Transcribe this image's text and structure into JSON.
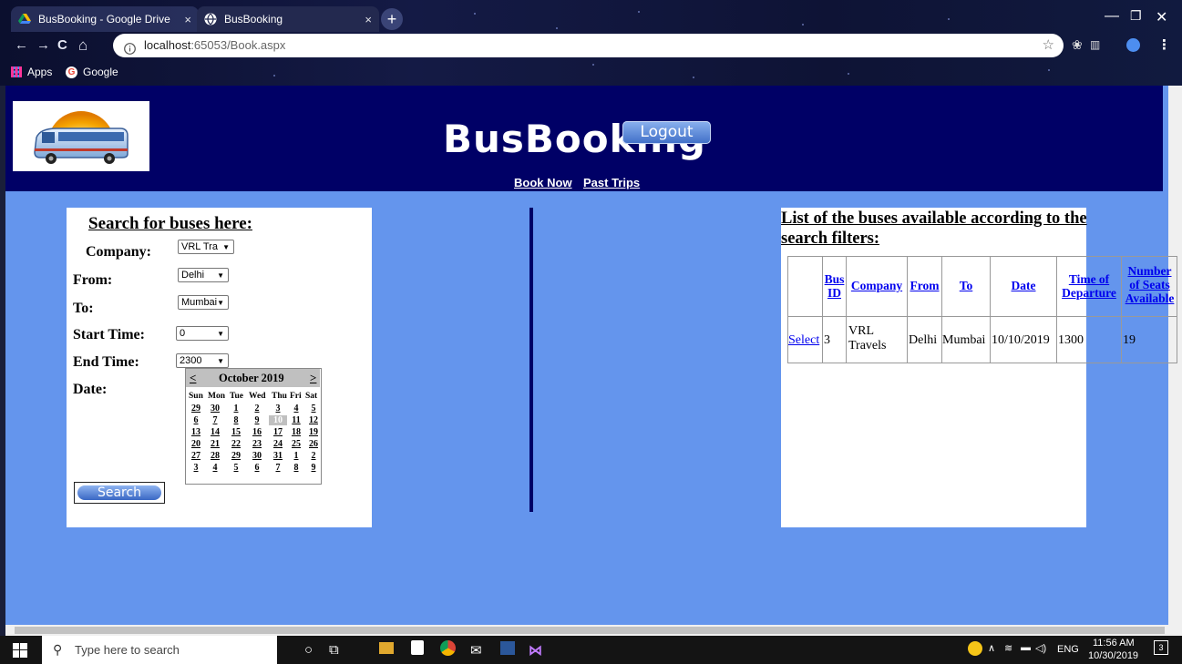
{
  "browser": {
    "tabs": [
      {
        "title": "BusBooking - Google Drive",
        "close": "×"
      },
      {
        "title": "BusBooking",
        "close": "×"
      }
    ],
    "new_tab": "+",
    "window_controls": {
      "minimize": "—",
      "maximize": "❐",
      "close": "✕"
    },
    "nav": {
      "back": "←",
      "forward": "→",
      "reload": "C",
      "home": "⌂"
    },
    "url_host": "localhost",
    "url_path": ":65053/Book.aspx",
    "bookmarks": [
      {
        "label": "Apps"
      },
      {
        "label": "Google"
      }
    ]
  },
  "site": {
    "title": "BusBooking",
    "logout_label": "Logout",
    "menu": [
      "Book Now",
      "Past Trips"
    ]
  },
  "search": {
    "heading": "Search for buses here:",
    "fields": {
      "company": {
        "label": "Company:",
        "value": "VRL Tra"
      },
      "from": {
        "label": "From:",
        "value": "Delhi"
      },
      "to": {
        "label": "To:",
        "value": "Mumbai"
      },
      "start_time": {
        "label": "Start Time:",
        "value": "0"
      },
      "end_time": {
        "label": "End Time:",
        "value": "2300"
      },
      "date": {
        "label": "Date:"
      }
    },
    "calendar": {
      "prev": "<",
      "next": ">",
      "month": "October 2019",
      "days_of_week": [
        "Sun",
        "Mon",
        "Tue",
        "Wed",
        "Thu",
        "Fri",
        "Sat"
      ],
      "weeks": [
        [
          "29",
          "30",
          "1",
          "2",
          "3",
          "4",
          "5"
        ],
        [
          "6",
          "7",
          "8",
          "9",
          "10",
          "11",
          "12"
        ],
        [
          "13",
          "14",
          "15",
          "16",
          "17",
          "18",
          "19"
        ],
        [
          "20",
          "21",
          "22",
          "23",
          "24",
          "25",
          "26"
        ],
        [
          "27",
          "28",
          "29",
          "30",
          "31",
          "1",
          "2"
        ],
        [
          "3",
          "4",
          "5",
          "6",
          "7",
          "8",
          "9"
        ]
      ],
      "selected": "10"
    },
    "button_label": "Search"
  },
  "results": {
    "heading": "List of the buses available according to the search filters:",
    "columns": [
      "",
      "Bus ID",
      "Company",
      "From",
      "To",
      "Date",
      "Time of Departure",
      "Number of Seats Available"
    ],
    "rows": [
      {
        "select": "Select",
        "bus_id": "3",
        "company": "VRL Travels",
        "from": "Delhi",
        "to": "Mumbai",
        "date": "10/10/2019",
        "time": "1300",
        "seats": "19"
      }
    ]
  },
  "taskbar": {
    "search_placeholder": "Type here to search",
    "language": "ENG",
    "time": "11:56 AM",
    "date": "10/30/2019",
    "notifications": "3"
  },
  "colors": {
    "page_bg": "#6495ED",
    "header_bg": "#000066",
    "link": "#0000EE",
    "selected_day": "#c0c0c0"
  }
}
